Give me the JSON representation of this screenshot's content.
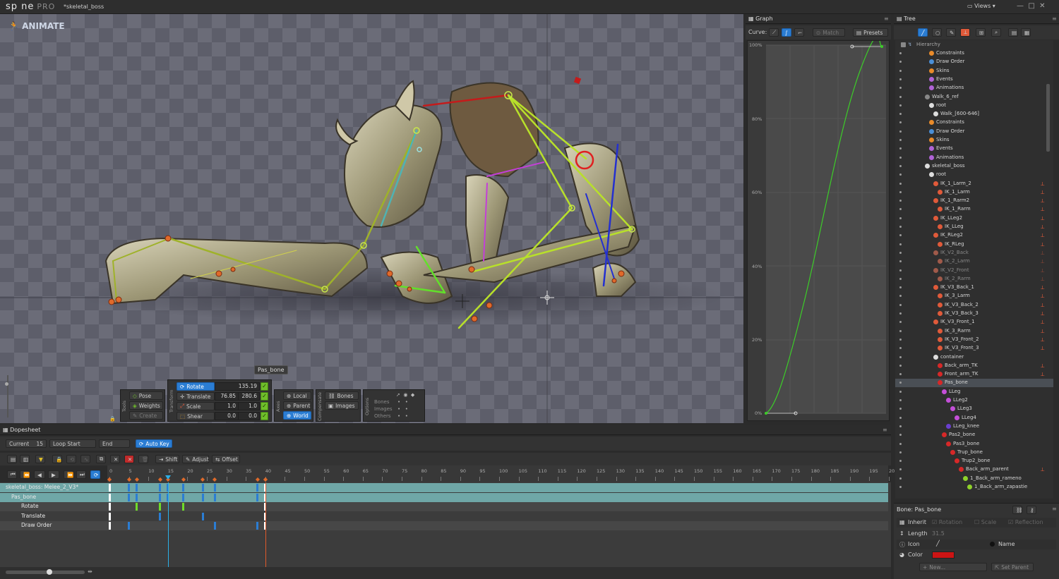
{
  "app": {
    "logo": "sp ne",
    "logo_pro": "PRO",
    "document_title": "*skeletal_boss",
    "views_label": "Views"
  },
  "viewport": {
    "mode_label": "ANIMATE",
    "selected_bone_label": "Pas_bone"
  },
  "tools": {
    "group_label": "Tools",
    "items": [
      {
        "label": "Pose"
      },
      {
        "label": "Weights"
      },
      {
        "label": "Create"
      }
    ]
  },
  "transform": {
    "group_label": "Transform",
    "rows": [
      {
        "label": "Rotate",
        "v1": "",
        "v2": "135.19"
      },
      {
        "label": "Translate",
        "v1": "76.85",
        "v2": "280.6"
      },
      {
        "label": "Scale",
        "v1": "1.0",
        "v2": "1.0"
      },
      {
        "label": "Shear",
        "v1": "0.0",
        "v2": "0.0"
      }
    ]
  },
  "axes": {
    "group_label": "Axes",
    "items": [
      {
        "label": "Local"
      },
      {
        "label": "Parent"
      },
      {
        "label": "World"
      }
    ]
  },
  "compensate": {
    "group_label": "Compensate",
    "items": [
      {
        "label": "Bones"
      },
      {
        "label": "Images"
      }
    ]
  },
  "options": {
    "group_label": "Options",
    "rows": [
      {
        "label": "Bones"
      },
      {
        "label": "Images"
      },
      {
        "label": "Others"
      }
    ]
  },
  "graph": {
    "title": "Graph",
    "curve_label": "Curve:",
    "match_label": "Match",
    "presets_label": "Presets",
    "y_ticks": [
      "100%",
      "80%",
      "60%",
      "40%",
      "20%",
      "0%"
    ]
  },
  "tree": {
    "title": "Tree",
    "hierarchy_label": "Hierarchy",
    "items": [
      {
        "label": "Constraints",
        "indent": 3,
        "color": "#e98b2a"
      },
      {
        "label": "Draw Order",
        "indent": 3,
        "color": "#4a8fd8"
      },
      {
        "label": "Skins",
        "indent": 3,
        "color": "#e98b2a"
      },
      {
        "label": "Events",
        "indent": 3,
        "color": "#b063d6"
      },
      {
        "label": "Animations",
        "indent": 3,
        "color": "#b063d6"
      },
      {
        "label": "Walk_6_ref",
        "indent": 2,
        "color": "#888888"
      },
      {
        "label": "root",
        "indent": 3,
        "color": "#dddddd"
      },
      {
        "label": "Walk_[600-646]",
        "indent": 4,
        "color": "#dddddd"
      },
      {
        "label": "Constraints",
        "indent": 3,
        "color": "#e98b2a"
      },
      {
        "label": "Draw Order",
        "indent": 3,
        "color": "#4a8fd8"
      },
      {
        "label": "Skins",
        "indent": 3,
        "color": "#e98b2a"
      },
      {
        "label": "Events",
        "indent": 3,
        "color": "#b063d6"
      },
      {
        "label": "Animations",
        "indent": 3,
        "color": "#b063d6"
      },
      {
        "label": "skeletal_boss",
        "indent": 2,
        "color": "#dddddd"
      },
      {
        "label": "root",
        "indent": 3,
        "color": "#dddddd"
      },
      {
        "label": "IK_1_Larm_2",
        "indent": 4,
        "color": "#e05a3a",
        "ik": true
      },
      {
        "label": "IK_1_Larm",
        "indent": 5,
        "color": "#e05a3a",
        "ik": true
      },
      {
        "label": "IK_1_Rarm2",
        "indent": 4,
        "color": "#e05a3a",
        "ik": true
      },
      {
        "label": "IK_1_Rarm",
        "indent": 5,
        "color": "#e05a3a",
        "ik": true
      },
      {
        "label": "IK_LLeg2",
        "indent": 4,
        "color": "#e05a3a",
        "ik": true
      },
      {
        "label": "IK_LLeg",
        "indent": 5,
        "color": "#e05a3a",
        "ik": true
      },
      {
        "label": "IK_RLeg2",
        "indent": 4,
        "color": "#e05a3a",
        "ik": true
      },
      {
        "label": "IK_RLeg",
        "indent": 5,
        "color": "#e05a3a",
        "ik": true
      },
      {
        "label": "IK_V2_Back",
        "indent": 4,
        "color": "#a05a4a",
        "ik": true,
        "dim": true
      },
      {
        "label": "IK_2_Larm",
        "indent": 5,
        "color": "#a05a4a",
        "ik": true,
        "dim": true
      },
      {
        "label": "IK_V2_Front",
        "indent": 4,
        "color": "#a05a4a",
        "ik": true,
        "dim": true
      },
      {
        "label": "IK_2_Rarm",
        "indent": 5,
        "color": "#a05a4a",
        "ik": true,
        "dim": true
      },
      {
        "label": "IK_V3_Back_1",
        "indent": 4,
        "color": "#e05a3a",
        "ik": true
      },
      {
        "label": "IK_3_Larm",
        "indent": 5,
        "color": "#e05a3a",
        "ik": true
      },
      {
        "label": "IK_V3_Back_2",
        "indent": 5,
        "color": "#e05a3a",
        "ik": true
      },
      {
        "label": "IK_V3_Back_3",
        "indent": 5,
        "color": "#e05a3a",
        "ik": true
      },
      {
        "label": "IK_V3_Front_1",
        "indent": 4,
        "color": "#e05a3a",
        "ik": true
      },
      {
        "label": "IK_3_Rarm",
        "indent": 5,
        "color": "#e05a3a",
        "ik": true
      },
      {
        "label": "IK_V3_Front_2",
        "indent": 5,
        "color": "#e05a3a",
        "ik": true
      },
      {
        "label": "IK_V3_Front_3",
        "indent": 5,
        "color": "#e05a3a",
        "ik": true
      },
      {
        "label": "container",
        "indent": 4,
        "color": "#dddddd"
      },
      {
        "label": "Back_arm_TK",
        "indent": 5,
        "color": "#d62828",
        "ik": true
      },
      {
        "label": "Front_arm_TK",
        "indent": 5,
        "color": "#d62828",
        "ik": true
      },
      {
        "label": "Pas_bone",
        "indent": 5,
        "color": "#d62828",
        "selected": true
      },
      {
        "label": "LLeg",
        "indent": 6,
        "color": "#c44fd8"
      },
      {
        "label": "LLeg2",
        "indent": 7,
        "color": "#c44fd8"
      },
      {
        "label": "LLeg3",
        "indent": 8,
        "color": "#c44fd8"
      },
      {
        "label": "LLeg4",
        "indent": 9,
        "color": "#c44fd8"
      },
      {
        "label": "LLeg_knee",
        "indent": 7,
        "color": "#6a3fd0"
      },
      {
        "label": "Pas2_bone",
        "indent": 6,
        "color": "#d62828"
      },
      {
        "label": "Pas3_bone",
        "indent": 7,
        "color": "#d62828"
      },
      {
        "label": "Trup_bone",
        "indent": 8,
        "color": "#d62828"
      },
      {
        "label": "Trup2_bone",
        "indent": 9,
        "color": "#d62828"
      },
      {
        "label": "Back_arm_parent",
        "indent": 10,
        "color": "#d62828",
        "ik": true
      },
      {
        "label": "1_Back_arm_rameno",
        "indent": 11,
        "color": "#8fd12a"
      },
      {
        "label": "1_Back_arm_zapastie",
        "indent": 12,
        "color": "#8fd12a"
      }
    ]
  },
  "bone_props": {
    "title": "Bone: Pas_bone",
    "inherit_label": "Inherit",
    "rotation_label": "Rotation",
    "scale_label": "Scale",
    "reflection_label": "Reflection",
    "length_label": "Length",
    "length_value": "31.5",
    "icon_label": "Icon",
    "name_label": "Name",
    "color_label": "Color",
    "color_value": "#cc1414",
    "new_label": "New...",
    "set_parent_label": "Set Parent"
  },
  "dopesheet": {
    "title": "Dopesheet",
    "current_label": "Current",
    "current_value": "15",
    "loop_start_label": "Loop Start",
    "end_label": "End",
    "auto_key_label": "Auto Key",
    "shift_label": "Shift",
    "adjust_label": "Adjust",
    "offset_label": "Offset",
    "ruler_labels": [
      "0",
      "5",
      "10",
      "15",
      "20",
      "25",
      "30",
      "35",
      "40",
      "45",
      "50",
      "55",
      "60",
      "65",
      "70",
      "75",
      "80",
      "85",
      "90",
      "95",
      "100",
      "105",
      "110",
      "115",
      "120",
      "125",
      "130",
      "135",
      "140",
      "145",
      "150",
      "155",
      "160",
      "165",
      "170",
      "175",
      "180",
      "185",
      "190",
      "195",
      "20"
    ],
    "current_frame": 15,
    "end_frame": 40,
    "rows": [
      {
        "label": "skeletal_boss: Melee_2_V3*",
        "keys": [
          0,
          5,
          7,
          13,
          15,
          19,
          24,
          27,
          38,
          40
        ]
      },
      {
        "label": "Pas_bone",
        "keys": [
          0,
          5,
          7,
          13,
          15,
          19,
          24,
          27,
          38,
          40
        ]
      },
      {
        "label": "Rotate",
        "keys": [
          0,
          7,
          13,
          19,
          40
        ]
      },
      {
        "label": "Translate",
        "keys": [
          0,
          13,
          24,
          40
        ]
      },
      {
        "label": "Draw Order",
        "keys": [
          0,
          5,
          27,
          38,
          40
        ]
      }
    ]
  }
}
